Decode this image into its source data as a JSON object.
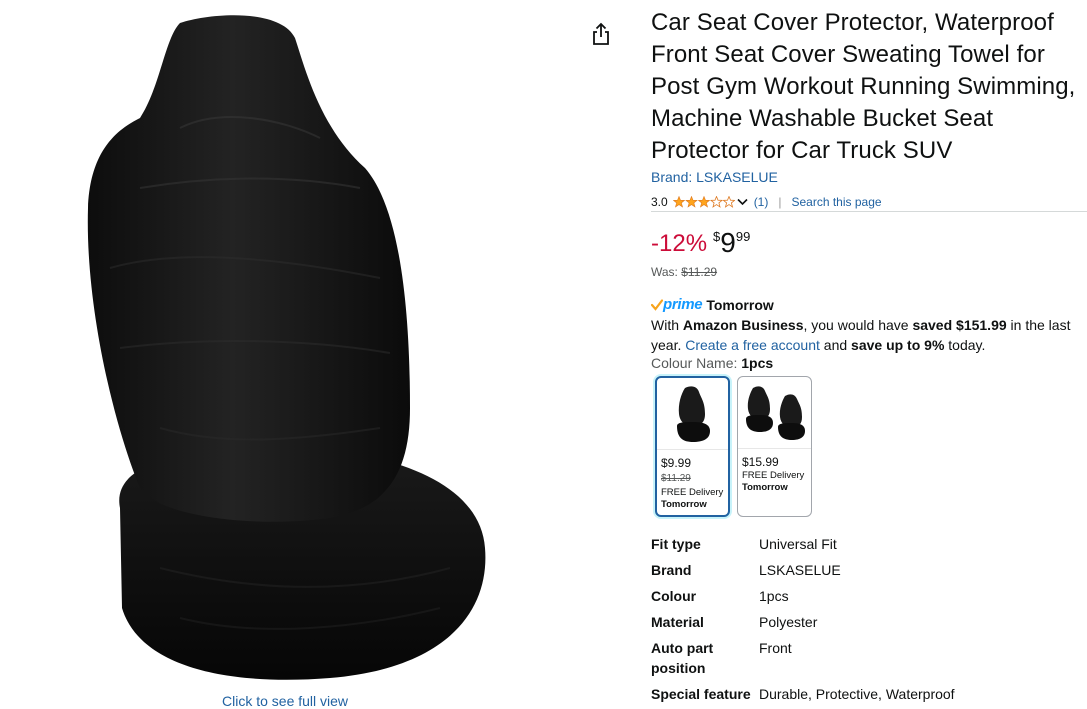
{
  "image_panel": {
    "full_view_label": "Click to see full view",
    "share_icon": "share-icon"
  },
  "product": {
    "title": "Car Seat Cover Protector, Waterproof Front Seat Cover Sweating Towel for Post Gym Workout Running Swimming, Machine Washable Bucket Seat Protector for Car Truck SUV",
    "brand_label": "Brand: LSKASELUE",
    "rating": {
      "value": "3.0",
      "stars_filled": 3,
      "stars_total": 5,
      "count": "(1)",
      "separator": "|",
      "search_label": "Search this page"
    },
    "price": {
      "discount": "-12%",
      "symbol": "$",
      "whole": "9",
      "fraction": "99",
      "was_label": "Was:",
      "was_price": "$11.29"
    },
    "delivery": {
      "prime_word": "prime",
      "when": "Tomorrow"
    },
    "business": {
      "t1": "With ",
      "b1": "Amazon Business",
      "t2": ", you would have ",
      "b2": "saved $151.99",
      "t3": " in the last year. ",
      "link": "Create a free account",
      "t4": " and ",
      "b3": "save up to 9%",
      "t5": " today."
    },
    "colour": {
      "label": "Colour Name: ",
      "selected": "1pcs"
    },
    "swatches": [
      {
        "price": "$9.99",
        "was": "$11.29",
        "delivery": "FREE Delivery",
        "when": "Tomorrow"
      },
      {
        "price": "$15.99",
        "delivery": "FREE Delivery",
        "when": "Tomorrow"
      }
    ],
    "specs": [
      {
        "key": "Fit type",
        "value": "Universal Fit"
      },
      {
        "key": "Brand",
        "value": "LSKASELUE"
      },
      {
        "key": "Colour",
        "value": "1pcs"
      },
      {
        "key": "Material",
        "value": "Polyester"
      },
      {
        "key": "Auto part position",
        "value": "Front"
      },
      {
        "key": "Special feature",
        "value": "Durable, Protective, Waterproof"
      }
    ]
  },
  "colors": {
    "link": "#2162a1",
    "discount": "#cc0c39",
    "star": "#ffa41c",
    "prime": "#1399ff"
  }
}
